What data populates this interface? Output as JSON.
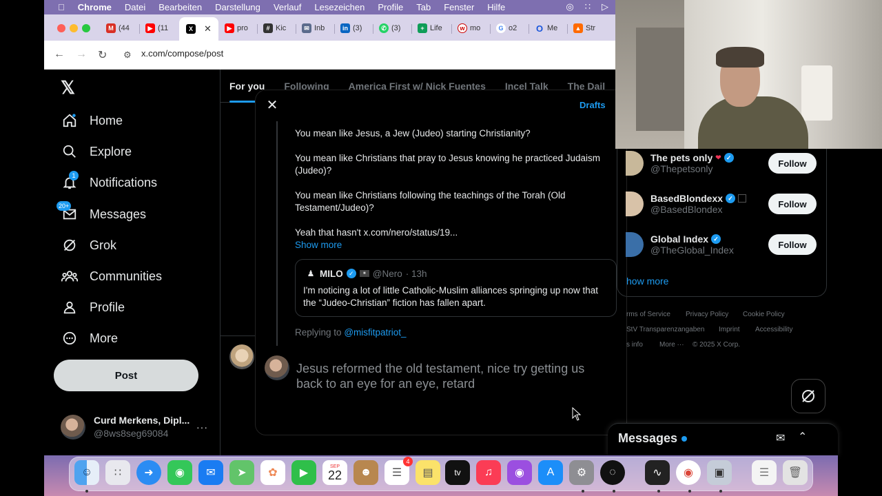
{
  "menubar": {
    "app": "Chrome",
    "items": [
      "Datei",
      "Bearbeiten",
      "Darstellung",
      "Verlauf",
      "Lesezeichen",
      "Profile",
      "Tab",
      "Fenster",
      "Hilfe"
    ]
  },
  "tabs": [
    {
      "label": "(44",
      "icon": "gmail-icon"
    },
    {
      "label": "(11",
      "icon": "youtube-icon"
    },
    {
      "label": "",
      "icon": "x-icon",
      "active": true
    },
    {
      "label": "pro",
      "icon": "youtube-icon"
    },
    {
      "label": "Kic",
      "icon": "grid-icon"
    },
    {
      "label": "Inb",
      "icon": "mail-icon"
    },
    {
      "label": "(3)",
      "icon": "linkedin-icon"
    },
    {
      "label": "(3)",
      "icon": "whatsapp-icon"
    },
    {
      "label": "Life",
      "icon": "sheet-icon"
    },
    {
      "label": "mo",
      "icon": "web-icon"
    },
    {
      "label": "o2",
      "icon": "google-icon"
    },
    {
      "label": "Me",
      "icon": "o-icon"
    },
    {
      "label": "Str",
      "icon": "stream-icon"
    }
  ],
  "toolbar": {
    "url": "x.com/compose/post"
  },
  "sidebar": {
    "items": [
      {
        "label": "Home",
        "icon": "home-icon"
      },
      {
        "label": "Explore",
        "icon": "search-icon"
      },
      {
        "label": "Notifications",
        "icon": "bell-icon",
        "badge": "1"
      },
      {
        "label": "Messages",
        "icon": "mail-icon",
        "badge": "20+"
      },
      {
        "label": "Grok",
        "icon": "grok-icon"
      },
      {
        "label": "Communities",
        "icon": "communities-icon"
      },
      {
        "label": "Profile",
        "icon": "person-icon"
      },
      {
        "label": "More",
        "icon": "more-circle-icon"
      }
    ],
    "post_label": "Post",
    "account_name": "Curd Merkens, Dipl...",
    "account_handle": "@8ws8seg69084"
  },
  "timeline_tabs": [
    "For you",
    "Following",
    "America First w/ Nick Fuentes",
    "Incel Talk",
    "The Dail"
  ],
  "modal": {
    "drafts": "Drafts",
    "paragraphs": [
      "You mean like Jesus, a Jew (Judeo) starting Christianity?",
      "You mean like Christians that pray to Jesus knowing he practiced Judaism (Judeo)?",
      "You mean like Christians following the teachings of the Torah (Old Testament/Judeo)?",
      "Yeah that hasn't x.com/nero/status/19..."
    ],
    "show_more": "Show more",
    "quote": {
      "name": "MILO",
      "handle": "@Nero",
      "time": "· 13h",
      "text": "I'm noticing a lot of little Catholic-Muslim alliances springing up now that the “Judeo-Christian” fiction has fallen apart."
    },
    "replying_prefix": "Replying to",
    "replying_handle": "@misfitpatriot_",
    "compose_text": "Jesus reformed the old testament, nice try getting us back to an eye for an eye, retard"
  },
  "who_to_follow": [
    {
      "name": "The pets only",
      "handle": "@Thepetsonly",
      "button": "Follow"
    },
    {
      "name": "BasedBlondexx",
      "handle": "@BasedBlondex",
      "button": "Follow"
    },
    {
      "name": "Global Index",
      "handle": "@TheGlobal_Index",
      "button": "Follow"
    }
  ],
  "show_more_right": "how more",
  "footer": [
    "rms of Service",
    "Privacy Policy",
    "Cookie Policy",
    "StV Transparenzangaben",
    "Imprint",
    "Accessibility",
    "s info",
    "More ···",
    "© 2025 X Corp."
  ],
  "messages_label": "Messages",
  "dock": {
    "calendar_month": "SEP",
    "calendar_day": "22",
    "reminders_badge": "4",
    "tv_label": "tv"
  },
  "colors": {
    "accent": "#1d9bf0",
    "background": "#000000",
    "menubar": "#7e6fb0"
  }
}
